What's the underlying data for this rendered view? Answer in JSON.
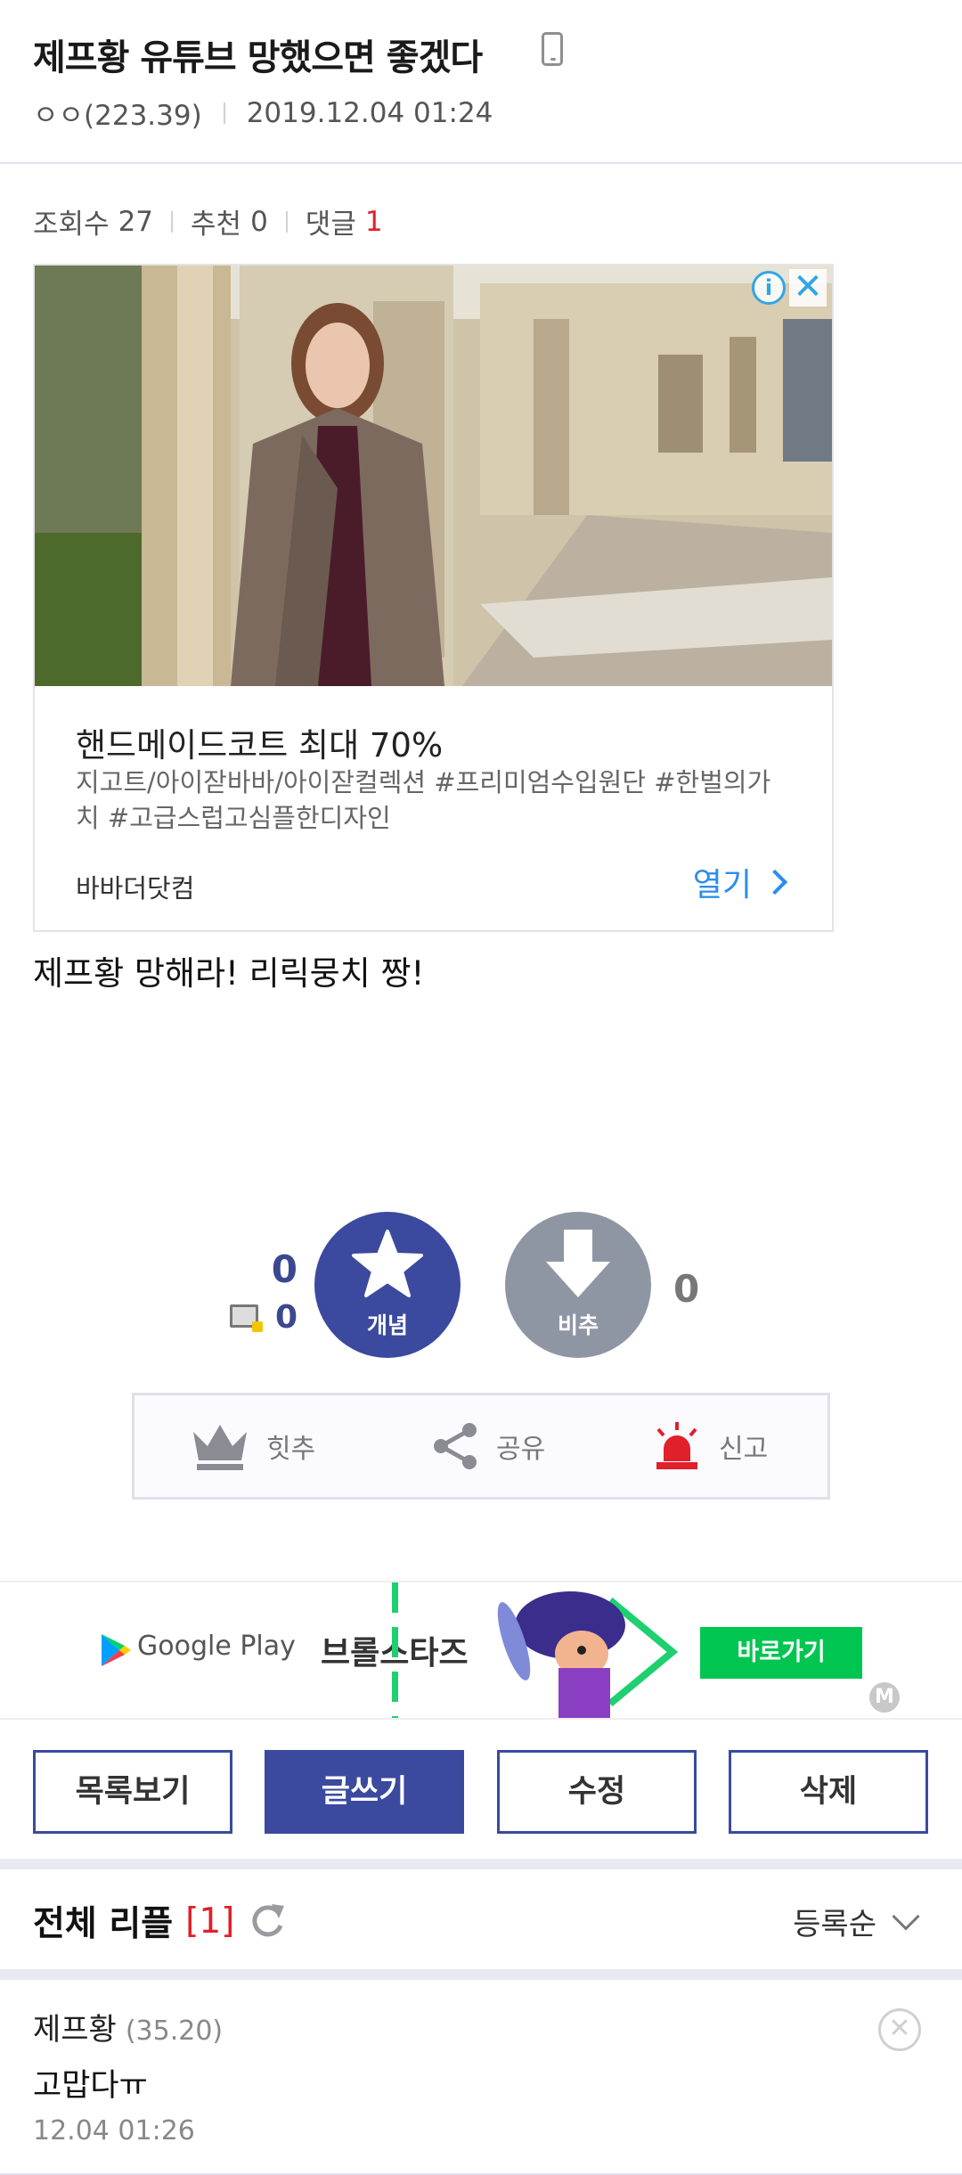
{
  "post": {
    "title": "제프황 유튜브 망했으면 좋겠다",
    "author": "ㅇㅇ(223.39)",
    "date": "2019.12.04 01:24",
    "views_label": "조회수",
    "views": "27",
    "recommend_label": "추천",
    "recommend": "0",
    "comments_label": "댓글",
    "comments": "1",
    "body": "제프황 망해라! 리릭뭉치 짱!"
  },
  "ad": {
    "headline": "핸드메이드코트 최대 70%",
    "description": "지고트/아이잗바바/아이잗컬렉션 #프리미엄수입원단 #한벌의가치 #고급스럽고심플한디자인",
    "brand": "바바더닷컴",
    "open_label": "열기",
    "info_glyph": "i",
    "close_glyph": "✕"
  },
  "vote": {
    "up_count": "0",
    "fixed_count": "0",
    "up_label": "개념",
    "down_label": "비추",
    "down_count": "0"
  },
  "actions": {
    "hit": "힛추",
    "share": "공유",
    "report": "신고"
  },
  "banner": {
    "store": "Google Play",
    "game": "브롤스타즈",
    "button": "바로가기",
    "badge": "M"
  },
  "buttons": {
    "list": "목록보기",
    "write": "글쓰기",
    "edit": "수정",
    "delete": "삭제"
  },
  "comments_section": {
    "title": "전체 리플",
    "count": "[1]",
    "sort": "등록순"
  },
  "comment": {
    "author": "제프황",
    "ip": "(35.20)",
    "text": "고맙다ㅠ",
    "date": "12.04 01:26",
    "delete_glyph": "✕"
  },
  "colors": {
    "accent": "#3b4a9e",
    "red": "#e0202a",
    "link_blue": "#2b8ee8",
    "green": "#00c551"
  }
}
